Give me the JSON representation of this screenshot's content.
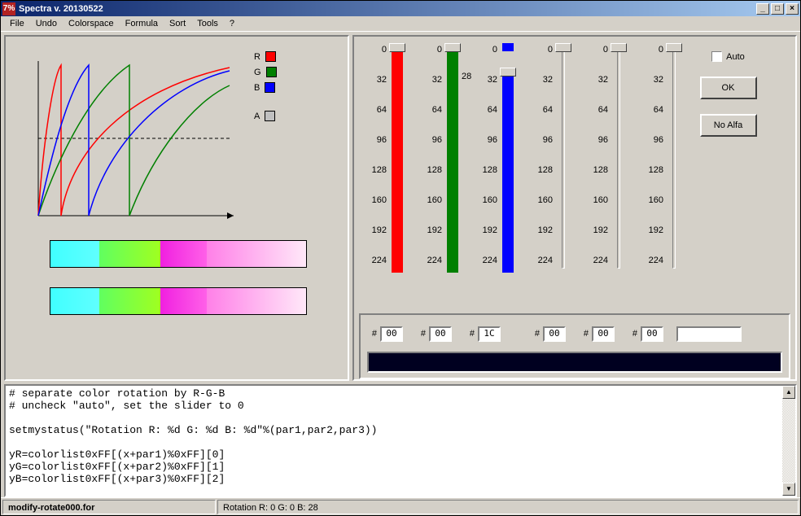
{
  "window": {
    "title": "Spectra v. 20130522",
    "icon_text": "7%"
  },
  "menu": [
    "File",
    "Undo",
    "Colorspace",
    "Formula",
    "Sort",
    "Tools",
    "?"
  ],
  "legend": [
    {
      "label": "R",
      "color": "#ff0000"
    },
    {
      "label": "G",
      "color": "#008000"
    },
    {
      "label": "B",
      "color": "#0000ff"
    },
    {
      "label": "A",
      "color": "#c0c0c0"
    }
  ],
  "slider_ticks": [
    "0",
    "32",
    "64",
    "96",
    "128",
    "160",
    "192",
    "224"
  ],
  "sliders": [
    {
      "fill": "red",
      "thumb_pos": 0,
      "thumb_label": ""
    },
    {
      "fill": "green",
      "thumb_pos": 0,
      "thumb_label": ""
    },
    {
      "fill": "blue",
      "thumb_pos": 30,
      "thumb_label": "28"
    },
    {
      "fill": "",
      "thumb_pos": 0,
      "thumb_label": ""
    },
    {
      "fill": "",
      "thumb_pos": 0,
      "thumb_label": ""
    },
    {
      "fill": "",
      "thumb_pos": 0,
      "thumb_label": ""
    }
  ],
  "auto": {
    "label": "Auto",
    "checked": false
  },
  "buttons": {
    "ok": "OK",
    "noalfa": "No Alfa"
  },
  "hex": {
    "prefix": "#",
    "values": [
      "00",
      "00",
      "1C",
      "00",
      "00",
      "00"
    ]
  },
  "code": "# separate color rotation by R-G-B\n# uncheck \"auto\", set the slider to 0\n\nsetmystatus(\"Rotation R: %d G: %d B: %d\"%(par1,par2,par3))\n\nyR=colorlist0xFF[(x+par1)%0xFF][0]\nyG=colorlist0xFF[(x+par2)%0xFF][1]\nyB=colorlist0xFF[(x+par3)%0xFF][2]",
  "status": {
    "file": "modify-rotate000.for",
    "msg": "Rotation R: 0 G: 0 B: 28"
  },
  "chart_data": {
    "type": "line",
    "title": "",
    "xlabel": "",
    "ylabel": "",
    "xlim": [
      0,
      256
    ],
    "ylim": [
      0,
      256
    ],
    "series": [
      {
        "name": "R",
        "color": "#ff0000",
        "note": "log-like rising curve, wraps at x≈32 from top back to 0"
      },
      {
        "name": "G",
        "color": "#008000",
        "note": "log-like rising curve, wraps at x≈128 from top back to 0"
      },
      {
        "name": "B",
        "color": "#0000ff",
        "note": "log-like rising curve, wraps at x≈67 from top back to 0"
      }
    ],
    "dashed_midline_y": 128
  },
  "gradient_segments": [
    {
      "w": 19,
      "bg": "linear-gradient(to right,#40ffff,#60ffff)"
    },
    {
      "w": 24,
      "bg": "linear-gradient(to right,#60ff60,#a0ff20)"
    },
    {
      "w": 18,
      "bg": "linear-gradient(to right,#f020e0,#ff60e8)"
    },
    {
      "w": 39,
      "bg": "linear-gradient(to right,#ff80e8,#ffe8f8)"
    }
  ]
}
